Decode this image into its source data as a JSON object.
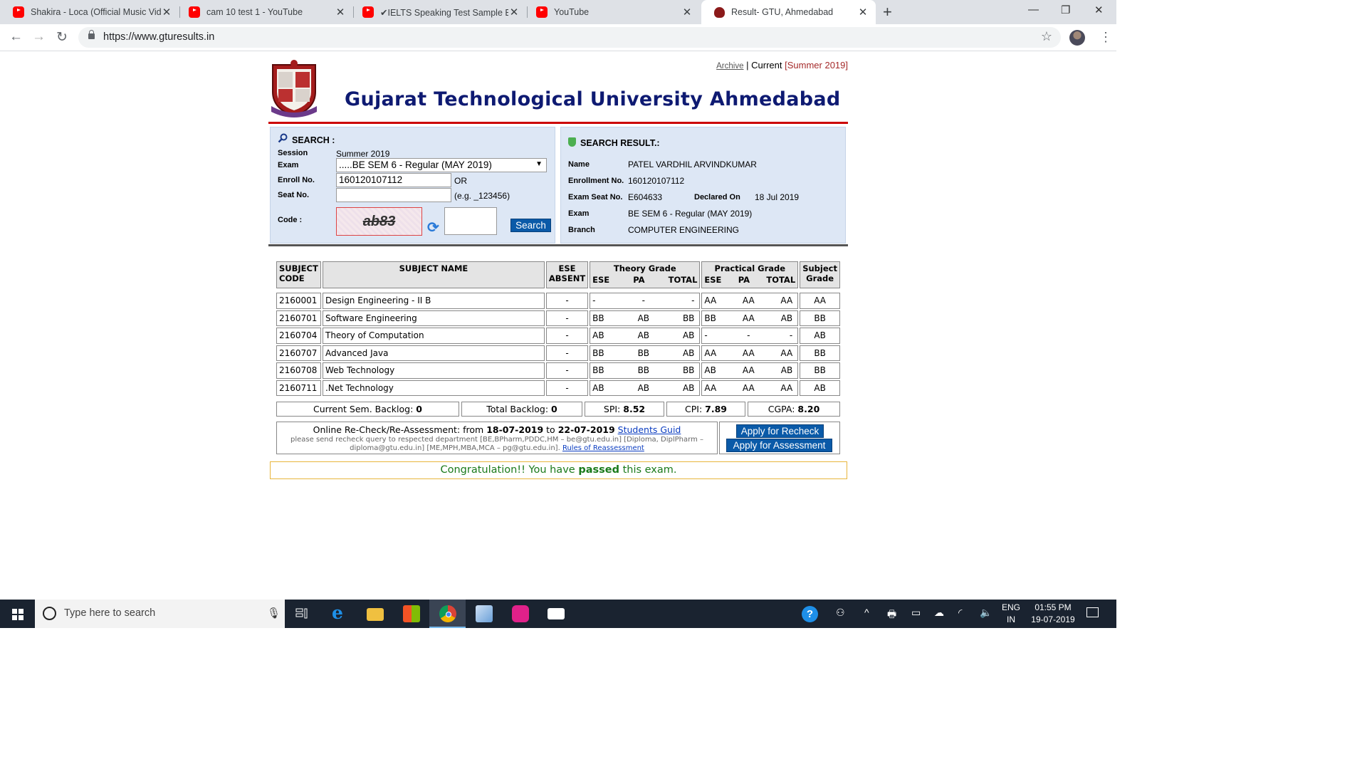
{
  "browser": {
    "tabs": [
      {
        "title": "Shakira - Loca (Official Music Vid",
        "favicon": "youtube-icon"
      },
      {
        "title": "cam 10 test 1 - YouTube",
        "favicon": "youtube-icon"
      },
      {
        "title": "✔IELTS Speaking Test Sample Ba",
        "favicon": "youtube-icon"
      },
      {
        "title": "YouTube",
        "favicon": "youtube-icon"
      },
      {
        "title": "Result- GTU, Ahmedabad",
        "favicon": "gtu-favicon",
        "active": true
      }
    ],
    "url": "https://www.gturesults.in",
    "controls": {
      "back": "←",
      "forward": "→",
      "reload": "↻",
      "new_tab": "+",
      "minimize": "—",
      "restore": "❐",
      "close": "✕",
      "star": "☆",
      "menu": "⋮",
      "tab_close": "✕"
    }
  },
  "site": {
    "nav": {
      "archive": "Archive",
      "separator": "|",
      "current": "Current",
      "session": "[Summer 2019]"
    },
    "university_name": "Gujarat Technological University Ahmedabad"
  },
  "search": {
    "title": "SEARCH :",
    "session_label": "Session",
    "session_value": "Summer 2019",
    "exam_label": "Exam",
    "exam_selected": ".....BE SEM 6 - Regular (MAY 2019)",
    "enroll_label": "Enroll No.",
    "enroll_value": "160120107112",
    "or_text": "OR",
    "seat_label": "Seat No.",
    "seat_value": "",
    "seat_hint": "(e.g. _123456)",
    "code_label": "Code :",
    "captcha_text": "ab83",
    "code_value": "",
    "search_button": "Search"
  },
  "result": {
    "title": "SEARCH RESULT.:",
    "name_label": "Name",
    "name_value": "PATEL VARDHIL ARVINDKUMAR",
    "enrollment_label": "Enrollment No.",
    "enrollment_value": "160120107112",
    "seat_label": "Exam Seat No.",
    "seat_value": "E604633",
    "declared_label": "Declared On",
    "declared_value": "18 Jul 2019",
    "exam_label": "Exam",
    "exam_value": "BE SEM 6 - Regular (MAY 2019)",
    "branch_label": "Branch",
    "branch_value": "COMPUTER ENGINEERING"
  },
  "grades": {
    "headers": {
      "code": "SUBJECT CODE",
      "name": "SUBJECT NAME",
      "ese_absent": "ESE ABSENT",
      "theory": "Theory Grade",
      "practical": "Practical Grade",
      "subject_grade": "Subject Grade",
      "ese": "ESE",
      "pa": "PA",
      "total": "TOTAL"
    },
    "rows": [
      {
        "code": "2160001",
        "name": "Design Engineering - II B",
        "absent": "-",
        "t_ese": "-",
        "t_pa": "-",
        "t_total": "-",
        "p_ese": "AA",
        "p_pa": "AA",
        "p_total": "AA",
        "grade": "AA"
      },
      {
        "code": "2160701",
        "name": "Software Engineering",
        "absent": "-",
        "t_ese": "BB",
        "t_pa": "AB",
        "t_total": "BB",
        "p_ese": "BB",
        "p_pa": "AA",
        "p_total": "AB",
        "grade": "BB"
      },
      {
        "code": "2160704",
        "name": "Theory of Computation",
        "absent": "-",
        "t_ese": "AB",
        "t_pa": "AB",
        "t_total": "AB",
        "p_ese": "-",
        "p_pa": "-",
        "p_total": "-",
        "grade": "AB"
      },
      {
        "code": "2160707",
        "name": "Advanced Java",
        "absent": "-",
        "t_ese": "BB",
        "t_pa": "BB",
        "t_total": "AB",
        "p_ese": "AA",
        "p_pa": "AA",
        "p_total": "AA",
        "grade": "BB"
      },
      {
        "code": "2160708",
        "name": "Web Technology",
        "absent": "-",
        "t_ese": "BB",
        "t_pa": "BB",
        "t_total": "BB",
        "p_ese": "AB",
        "p_pa": "AA",
        "p_total": "AB",
        "grade": "BB"
      },
      {
        "code": "2160711",
        "name": ".Net Technology",
        "absent": "-",
        "t_ese": "AB",
        "t_pa": "AB",
        "t_total": "AB",
        "p_ese": "AA",
        "p_pa": "AA",
        "p_total": "AA",
        "grade": "AB"
      }
    ]
  },
  "summary": {
    "current_backlog_label": "Current Sem. Backlog:",
    "current_backlog": "0",
    "total_backlog_label": "Total Backlog:",
    "total_backlog": "0",
    "spi_label": "SPI:",
    "spi": "8.52",
    "cpi_label": "CPI:",
    "cpi": "7.89",
    "cgpa_label": "CGPA:",
    "cgpa": "8.20"
  },
  "recheck": {
    "prefix": "Online Re-Check/Re-Assessment: from",
    "from": "18-07-2019",
    "to_word": "to",
    "to": "22-07-2019",
    "guide_link": "Students Guid",
    "note": "please send recheck query to respected department [BE,BPharm,PDDC,HM – be@gtu.edu.in] [Diploma, DiplPharm – diploma@gtu.edu.in] [ME,MPH,MBA,MCA – pg@gtu.edu.in].",
    "rules_link": "Rules of Reassessment",
    "recheck_button": "Apply for Recheck",
    "assessment_button": "Apply for Assessment"
  },
  "message": {
    "prefix": "Congratulation!! You have",
    "emphasis": "passed",
    "suffix": "this exam."
  },
  "taskbar": {
    "search_placeholder": "Type here to search",
    "language_line1": "ENG",
    "language_line2": "IN",
    "time": "01:55 PM",
    "date": "19-07-2019"
  },
  "colors": {
    "university_title": "#0e1a72",
    "header_rule": "#cc0000",
    "button": "#0a5aa8",
    "pass_text": "#1a7a1a",
    "panel_bg": "#dde7f5"
  }
}
